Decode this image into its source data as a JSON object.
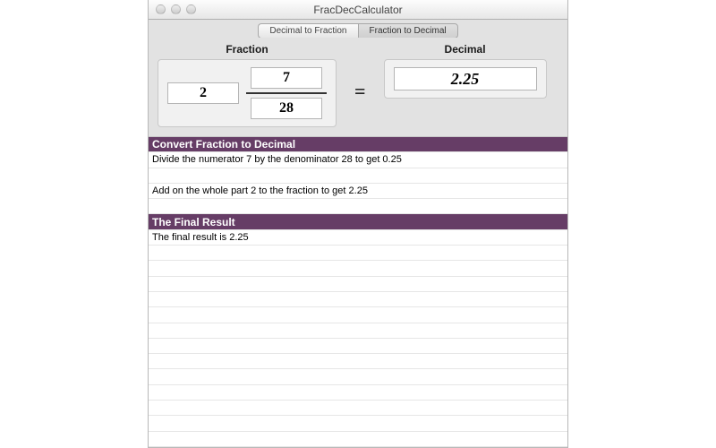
{
  "window": {
    "title": "FracDecCalculator"
  },
  "tabs": {
    "dec_to_frac": "Decimal to Fraction",
    "frac_to_dec": "Fraction to Decimal"
  },
  "labels": {
    "fraction": "Fraction",
    "decimal": "Decimal",
    "equals": "="
  },
  "inputs": {
    "whole": "2",
    "numerator": "7",
    "denominator": "28",
    "decimal_result": "2.25"
  },
  "steps": {
    "section1_title": "Convert Fraction to Decimal",
    "section1_line1": "Divide the numerator 7 by the denominator 28 to get 0.25",
    "section1_line2": "Add on the whole part 2 to the fraction to get 2.25",
    "section2_title": "The Final Result",
    "section2_line1": "The final result is 2.25"
  }
}
